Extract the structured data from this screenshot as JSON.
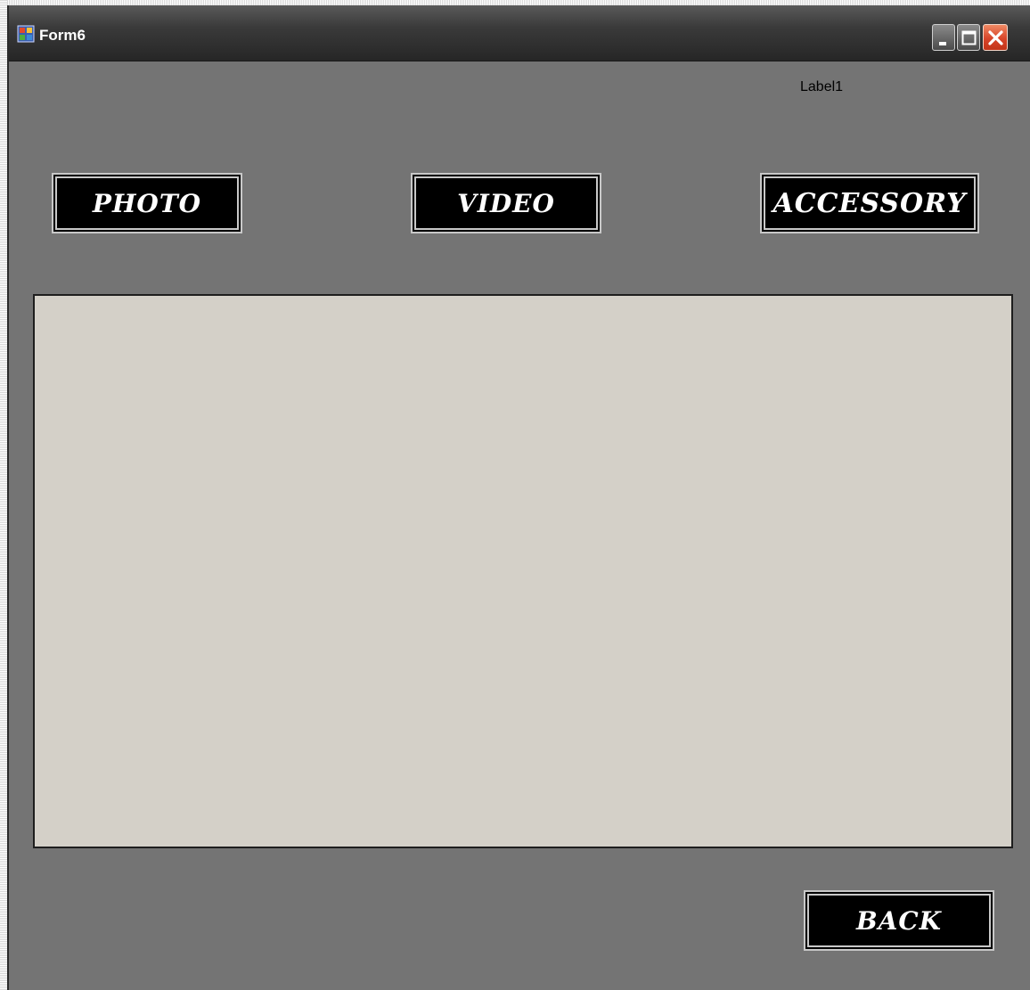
{
  "window": {
    "title": "Form6",
    "icon": "windows-forms-app-icon",
    "controls": {
      "minimize": "minimize-icon",
      "maximize": "maximize-icon",
      "close": "close-icon"
    }
  },
  "form": {
    "label1": "Label1",
    "buttons": {
      "photo": "PHOTO",
      "video": "VIDEO",
      "accessory": "ACCESSORY",
      "back": "BACK"
    }
  },
  "colors": {
    "form_background": "#747474",
    "panel_background": "#d4d0c8",
    "button_background": "#000000",
    "button_text": "#ffffff",
    "close_button": "#d8452a"
  }
}
